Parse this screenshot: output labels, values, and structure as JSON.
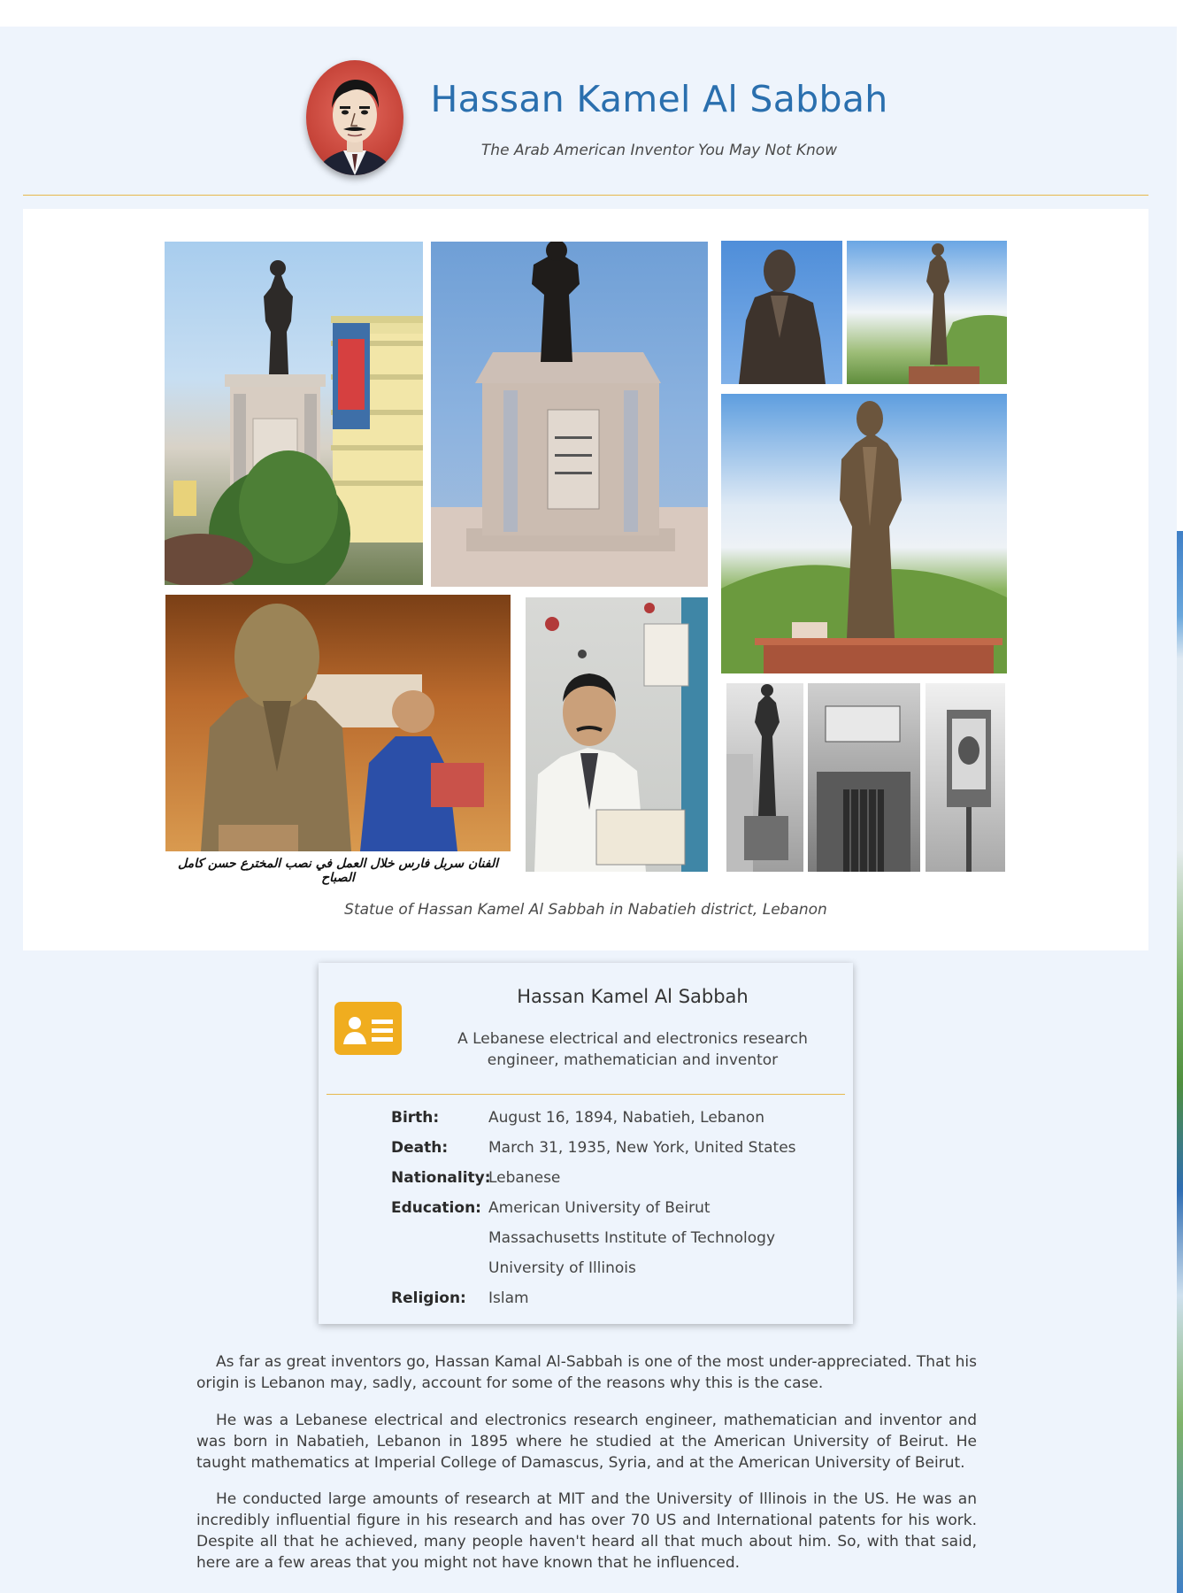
{
  "header": {
    "title": "Hassan Kamel Al Sabbah",
    "subtitle": "The Arab American Inventor You May Not Know"
  },
  "gallery": {
    "caption": "Statue of Hassan Kamel Al Sabbah in Nabatieh district, Lebanon",
    "photo_caption_arabic": "الفنان سربل فارس خلال العمل في نصب المخترع حسن كامل الصباح",
    "photos": [
      "statue-front-building",
      "statue-pedestal",
      "statue-closeup",
      "statue-hillside-small",
      "statue-hillside-large",
      "sculptor-at-work",
      "wax-figure",
      "monochrome-statue",
      "monochrome-gate",
      "monochrome-portrait"
    ]
  },
  "infobox": {
    "icon": "id-card-icon",
    "name": "Hassan Kamel Al Sabbah",
    "description": "A Lebanese electrical and electronics research engineer, mathematician and inventor",
    "rows": [
      {
        "label": "Birth:",
        "values": [
          "August 16, 1894, Nabatieh, Lebanon"
        ]
      },
      {
        "label": "Death:",
        "values": [
          "March 31, 1935, New York, United States"
        ]
      },
      {
        "label": "Nationality:",
        "values": [
          "Lebanese"
        ]
      },
      {
        "label": "Education:",
        "values": [
          "American University of Beirut",
          "Massachusetts Institute of Technology",
          "University of Illinois"
        ]
      },
      {
        "label": "Religion:",
        "values": [
          "Islam"
        ]
      }
    ]
  },
  "article": {
    "paragraphs": [
      "As far as great inventors go, Hassan Kamal Al-Sabbah is one of the most under-appreciated. That his origin is Lebanon may, sadly, account for some of the reasons why this is the case.",
      "He was a Lebanese electrical and electronics research engineer, mathematician and inventor and was born in Nabatieh, Lebanon in 1895 where he studied at the American University of Beirut. He taught mathematics at Imperial College of Damascus, Syria, and at the American University of Beirut.",
      "He conducted large amounts of research at MIT and the University of Illinois in the US. He was an incredibly influential figure in his research and has over 70 US and International patents for his work. Despite all that he achieved, many people haven't heard all that much about him. So, with that said, here are a few areas that you might not have known that he influenced."
    ]
  },
  "colors": {
    "accent": "#2a6fae",
    "divider": "#e6b84d",
    "icon": "#f0ad1f",
    "page_bg": "#eef4fc"
  }
}
